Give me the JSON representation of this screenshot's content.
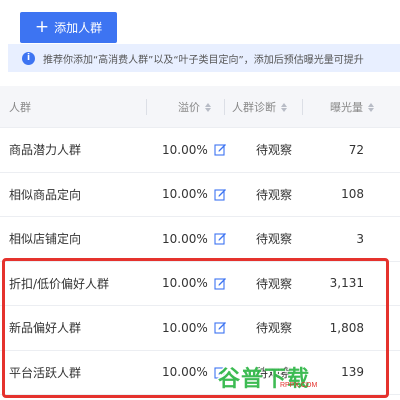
{
  "toolbar": {
    "add_label": "添加人群",
    "plus": "+"
  },
  "tip": {
    "icon": "i",
    "text": "推荐你添加“高消费人群”以及“叶子类目定向”，添加后预估曝光量可提升"
  },
  "table": {
    "columns": {
      "name": "人群",
      "premium": "溢价",
      "diagnosis": "人群诊断",
      "exposure": "曝光量"
    },
    "rows": [
      {
        "name": "商品潜力人群",
        "premium": "10.00%",
        "diagnosis": "待观察",
        "exposure": "72"
      },
      {
        "name": "相似商品定向",
        "premium": "10.00%",
        "diagnosis": "待观察",
        "exposure": "108"
      },
      {
        "name": "相似店铺定向",
        "premium": "10.00%",
        "diagnosis": "待观察",
        "exposure": "3"
      },
      {
        "name": "折扣/低价偏好人群",
        "premium": "10.00%",
        "diagnosis": "待观察",
        "exposure": "3,131"
      },
      {
        "name": "新品偏好人群",
        "premium": "10.00%",
        "diagnosis": "待观察",
        "exposure": "1,808"
      },
      {
        "name": "平台活跃人群",
        "premium": "10.00%",
        "diagnosis": "待观察",
        "exposure": "139"
      }
    ]
  },
  "watermark": {
    "text": "谷普下载",
    "badge": "RPPX.COM"
  },
  "colors": {
    "primary": "#3d74f2",
    "tip_bg": "#e8efff",
    "header_bg": "#f5f6f9",
    "highlight": "#e5322d",
    "watermark": "#33b84a"
  }
}
